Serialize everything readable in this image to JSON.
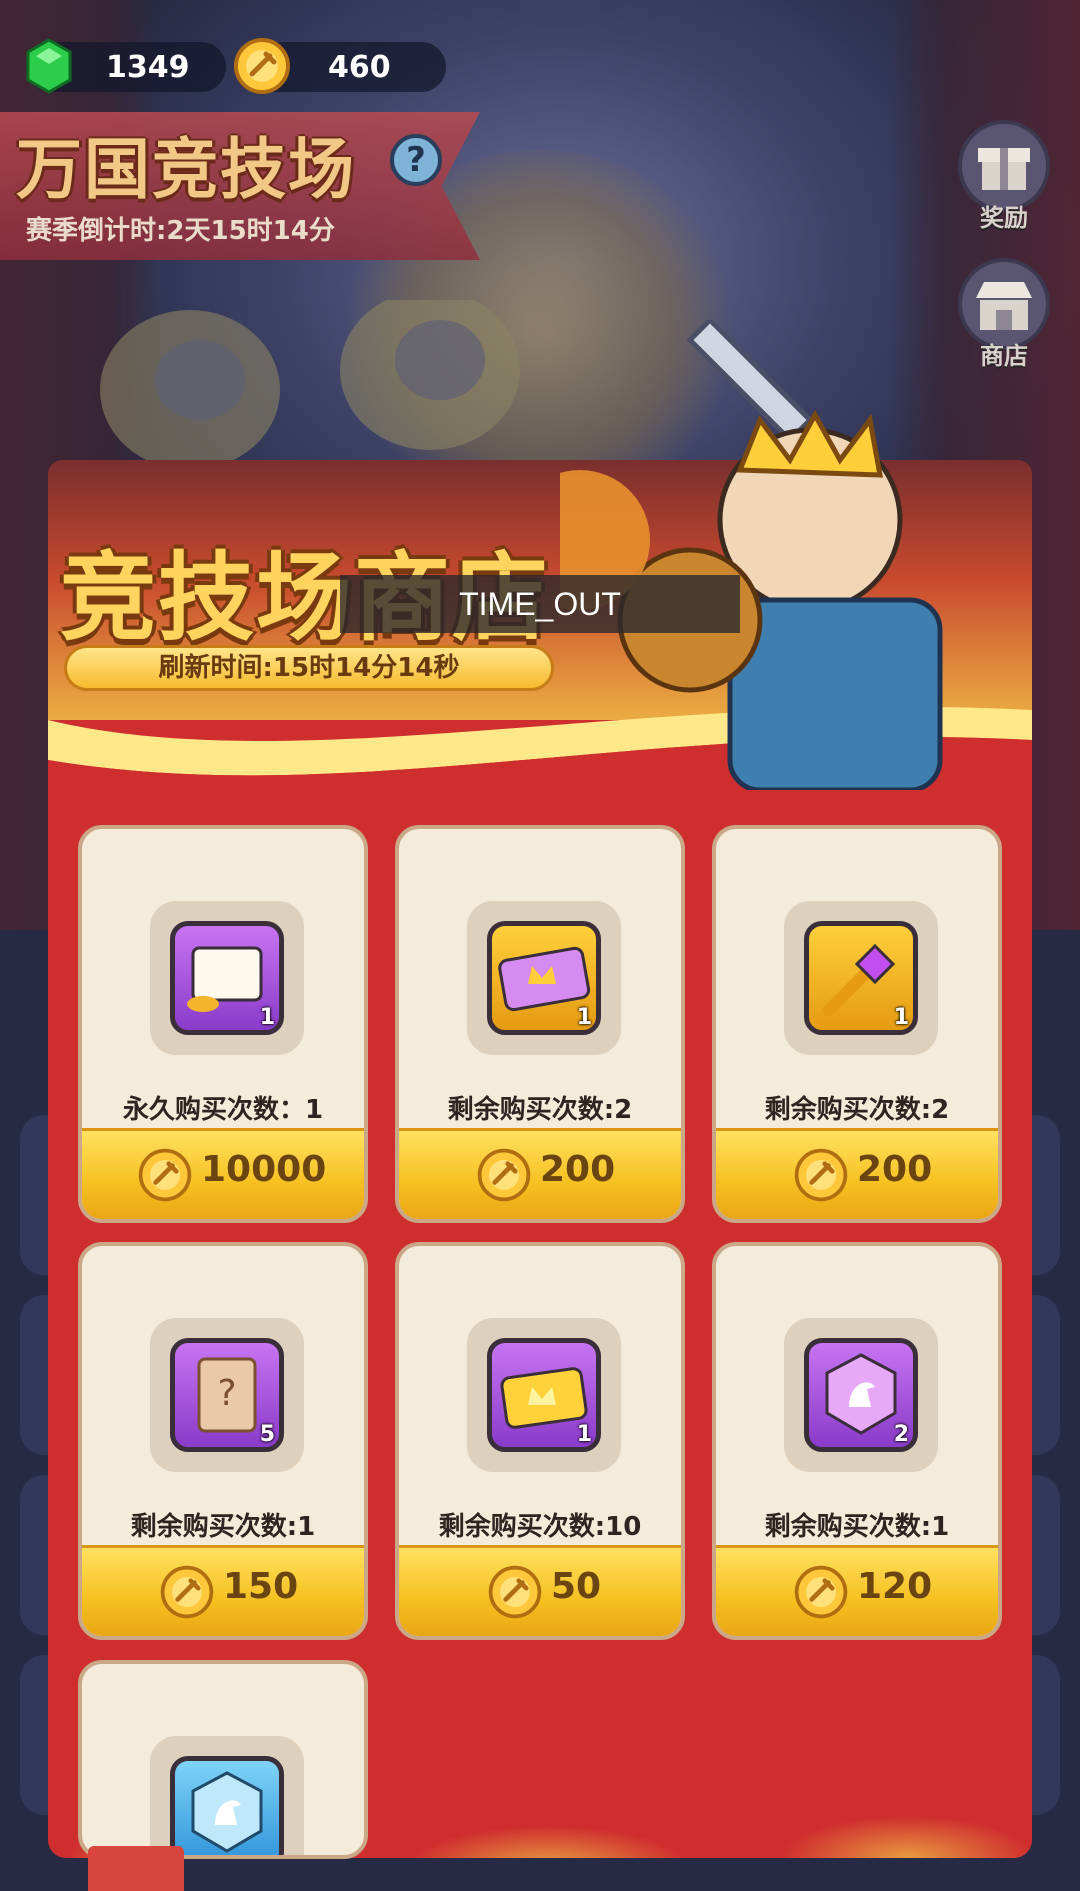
{
  "resources": {
    "gems": "1349",
    "coins": "460"
  },
  "arena": {
    "title": "万国竞技场",
    "help": "?",
    "countdown": "赛季倒计时:2天15时14分"
  },
  "side_buttons": [
    {
      "label": "奖励",
      "icon": "gift-icon"
    },
    {
      "label": "商店",
      "icon": "shop-icon"
    }
  ],
  "shop": {
    "title": "竞技场商店",
    "overlay_text": "TIME_OUT",
    "refresh": "刷新时间:15时14分14秒",
    "items": [
      {
        "icon": "frame-icon",
        "color": "purple",
        "qty": "1",
        "limit": "永久购买次数：1",
        "price": "10000"
      },
      {
        "icon": "crown-ticket-icon",
        "color": "gold",
        "qty": "1",
        "limit": "剩余购买次数:2",
        "price": "200"
      },
      {
        "icon": "scepter-icon",
        "color": "gold",
        "qty": "1",
        "limit": "剩余购买次数:2",
        "price": "200"
      },
      {
        "icon": "mystery-scroll-icon",
        "color": "purple",
        "qty": "5",
        "limit": "剩余购买次数:1",
        "price": "150"
      },
      {
        "icon": "gold-ticket-icon",
        "color": "purple",
        "qty": "1",
        "limit": "剩余购买次数:10",
        "price": "50"
      },
      {
        "icon": "horse-badge-icon",
        "color": "purple",
        "qty": "2",
        "limit": "剩余购买次数:1",
        "price": "120"
      },
      {
        "icon": "blue-horse-badge-icon",
        "color": "blue",
        "qty": "",
        "limit": "",
        "price": ""
      }
    ]
  }
}
